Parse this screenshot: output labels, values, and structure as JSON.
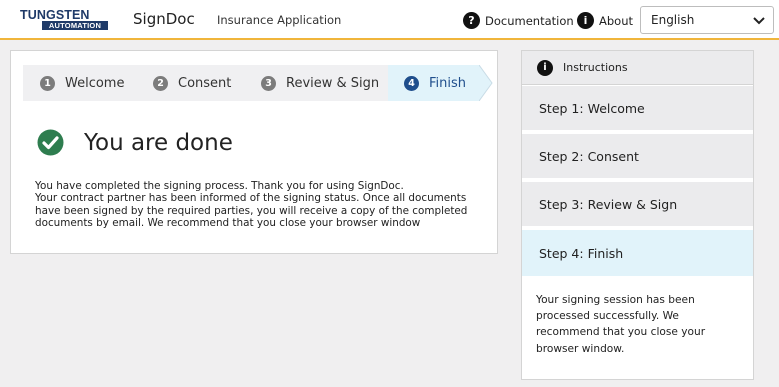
{
  "header": {
    "logo_top": "TUNGSTEN",
    "logo_bottom": "AUTOMATION",
    "app_name": "SignDoc",
    "document_title": "Insurance Application",
    "documentation_label": "Documentation",
    "documentation_icon": "question-circle-icon",
    "about_label": "About",
    "about_icon": "info-circle-icon",
    "language_selected": "English"
  },
  "steps": [
    {
      "number": "1",
      "label": "Welcome"
    },
    {
      "number": "2",
      "label": "Consent"
    },
    {
      "number": "3",
      "label": "Review & Sign"
    },
    {
      "number": "4",
      "label": "Finish",
      "active": true
    }
  ],
  "main": {
    "title": "You are done",
    "message_lines": [
      "You have completed the signing process. Thank you for using SignDoc.",
      "Your contract partner has been informed of the signing status. Once all documents",
      "have been signed by the required parties, you will receive a copy of the completed",
      "documents by email. We recommend that you close your browser window"
    ]
  },
  "instructions": {
    "title": "Instructions",
    "steps": [
      {
        "label": "Step 1: Welcome"
      },
      {
        "label": "Step 2: Consent"
      },
      {
        "label": "Step 3: Review & Sign"
      },
      {
        "label": "Step 4: Finish",
        "active": true
      }
    ],
    "message_lines": [
      "Your signing session has been",
      "processed successfully. We",
      "recommend that you close your",
      "browser window."
    ]
  },
  "colors": {
    "brand_navy": "#1f3a68",
    "header_accent": "#f0b53b",
    "success_green": "#2e7d4f",
    "active_step_bg": "#e1f3fa",
    "active_step_text": "#1f4e8c"
  }
}
